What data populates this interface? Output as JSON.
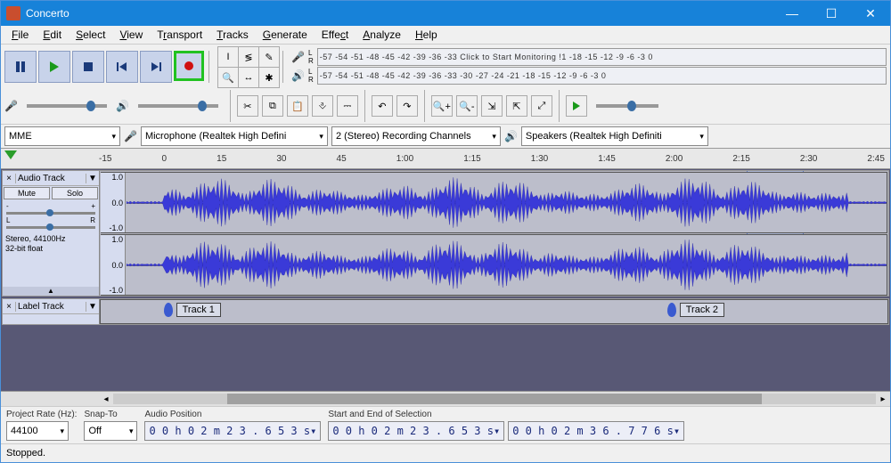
{
  "window": {
    "title": "Concerto"
  },
  "menu": [
    "File",
    "Edit",
    "Select",
    "View",
    "Transport",
    "Tracks",
    "Generate",
    "Effect",
    "Analyze",
    "Help"
  ],
  "meter": {
    "rec_text": "-57 -54 -51 -48 -45 -42 -39 -36 -33 Click to Start Monitoring !1 -18 -15 -12  -9  -6  -3  0",
    "play_text": "-57 -54 -51 -48 -45 -42 -39 -36 -33 -30 -27 -24 -21 -18 -15 -12  -9  -6  -3  0"
  },
  "device": {
    "host": "MME",
    "input": "Microphone (Realtek High Defini",
    "channels": "2 (Stereo) Recording Channels",
    "output": "Speakers (Realtek High Definiti"
  },
  "timeline": {
    "ticks": [
      "-15",
      "0",
      "15",
      "30",
      "45",
      "1:00",
      "1:15",
      "1:30",
      "1:45",
      "2:00",
      "2:15",
      "2:30",
      "2:45"
    ]
  },
  "audio_track": {
    "name": "Audio Track",
    "mute": "Mute",
    "solo": "Solo",
    "scale": [
      "1.0",
      "0.0",
      "-1.0"
    ],
    "info1": "Stereo, 44100Hz",
    "info2": "32-bit float"
  },
  "label_track": {
    "name": "Label Track",
    "labels": [
      {
        "text": "Track 1",
        "pos_pct": 8
      },
      {
        "text": "Track 2",
        "pos_pct": 72
      }
    ]
  },
  "bottom": {
    "rate_label": "Project Rate (Hz):",
    "rate": "44100",
    "snap_label": "Snap-To",
    "snap": "Off",
    "pos_label": "Audio Position",
    "pos": "0 0 h 0 2 m 2 3 . 6 5 3 s",
    "sel_label": "Start and End of Selection",
    "sel_start": "0 0 h 0 2 m 2 3 . 6 5 3 s",
    "sel_end": "0 0 h 0 2 m 3 6 . 7 7 6 s"
  },
  "status": "Stopped.",
  "selection": {
    "left_pct": 82,
    "width_pct": 7
  }
}
